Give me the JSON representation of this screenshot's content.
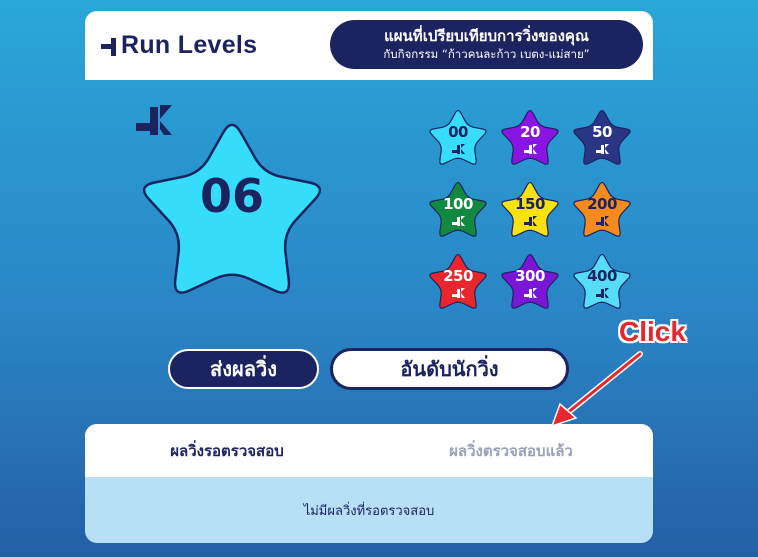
{
  "header": {
    "logo_text": "Run Levels",
    "banner_line1": "แผนที่เปรียบเทียบการวิ่งของคุณ",
    "banner_line2": "กับกิจกรรม “ก้าวคนละก้าว เบตง-แม่สาย”"
  },
  "current_level": {
    "value": "06",
    "unit_icon": "k-run-icon",
    "star_color": "#35ddfb"
  },
  "levels": [
    {
      "label": "00",
      "color": "#35ddfb",
      "text_color": "#1b2461"
    },
    {
      "label": "20",
      "color": "#8a15e3",
      "text_color": "#ffffff"
    },
    {
      "label": "50",
      "color": "#2a3585",
      "text_color": "#ffffff"
    },
    {
      "label": "100",
      "color": "#11893f",
      "text_color": "#ffffff"
    },
    {
      "label": "150",
      "color": "#f6e20f",
      "text_color": "#1b2461"
    },
    {
      "label": "200",
      "color": "#f58a1f",
      "text_color": "#1b2461"
    },
    {
      "label": "250",
      "color": "#e8262d",
      "text_color": "#ffffff"
    },
    {
      "label": "300",
      "color": "#7a16d6",
      "text_color": "#ffffff"
    },
    {
      "label": "400",
      "color": "#55dcf7",
      "text_color": "#1b2461"
    }
  ],
  "buttons": {
    "submit_label": "ส่งผลวิ่ง",
    "ranking_label": "อันดับนักวิ่ง"
  },
  "results": {
    "tab_pending": "ผลวิ่งรอตรวจสอบ",
    "tab_verified": "ผลวิ่งตรวจสอบแล้ว",
    "empty_message": "ไม่มีผลวิ่งที่รอตรวจสอบ"
  },
  "annotation": {
    "label": "Click",
    "color": "#e8262d"
  }
}
